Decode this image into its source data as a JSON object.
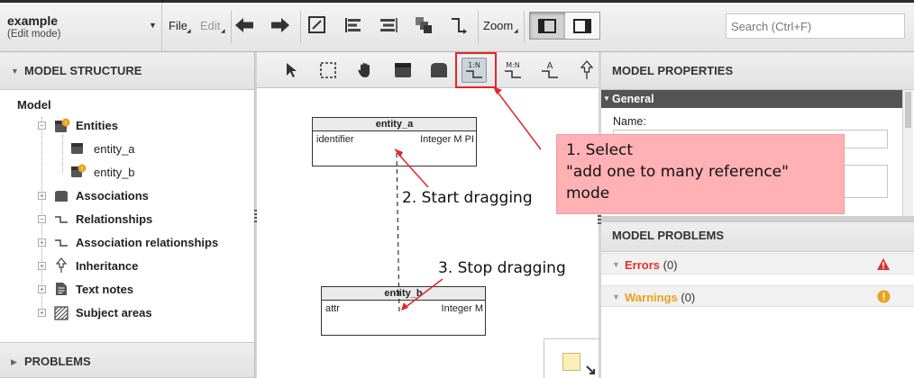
{
  "project": {
    "name": "example",
    "mode": "(Edit mode)"
  },
  "menu": {
    "file": "File",
    "edit": "Edit",
    "zoom": "Zoom"
  },
  "search": {
    "placeholder": "Search (Ctrl+F)"
  },
  "left_panel": {
    "header": "MODEL STRUCTURE",
    "root": "Model",
    "items": [
      {
        "label": "Entities",
        "expand": "−",
        "icon": "entity-warning-icon"
      },
      {
        "label": "entity_a",
        "icon": "entity-icon"
      },
      {
        "label": "entity_b",
        "icon": "entity-warning-icon"
      },
      {
        "label": "Associations",
        "expand": "+",
        "icon": "association-icon"
      },
      {
        "label": "Relationships",
        "expand": "−",
        "icon": "relationship-icon"
      },
      {
        "label": "Association relationships",
        "expand": "+",
        "icon": "relationship-icon"
      },
      {
        "label": "Inheritance",
        "expand": "+",
        "icon": "inheritance-icon"
      },
      {
        "label": "Text notes",
        "expand": "+",
        "icon": "note-icon"
      },
      {
        "label": "Subject areas",
        "expand": "+",
        "icon": "subject-area-icon"
      }
    ],
    "problems_header": "PROBLEMS"
  },
  "canvas": {
    "tool_1n_label": "1:N",
    "tool_mn_label": "M:N",
    "tool_inherit_label": "A",
    "entity_a": {
      "name": "entity_a",
      "attr": "identifier",
      "type": "Integer M PI"
    },
    "entity_b": {
      "name": "entity_b",
      "attr": "attr",
      "type": "Integer M"
    },
    "step2": "2. Start dragging",
    "step3": "3. Stop dragging"
  },
  "callout": {
    "line1": "1. Select",
    "line2": "\"add one to many reference\"",
    "line3": "mode"
  },
  "right_panel": {
    "properties_header": "MODEL PROPERTIES",
    "general_section": "General",
    "name_label": "Name:",
    "problems_header": "MODEL PROBLEMS",
    "errors_label": "Errors",
    "errors_count": "(0)",
    "warnings_label": "Warnings",
    "warnings_count": "(0)"
  },
  "colors": {
    "error": "#d9342b",
    "warning": "#e8a21c",
    "highlight": "#e3262c",
    "callout": "#ffb1b4"
  }
}
